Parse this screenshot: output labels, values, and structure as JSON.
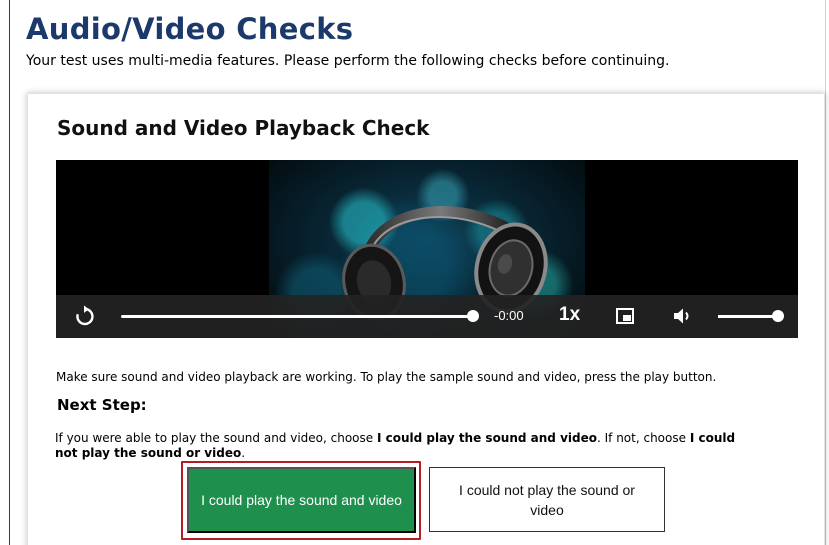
{
  "page": {
    "title": "Audio/Video Checks",
    "subtitle": "Your test uses multi-media features. Please perform the following checks before continuing."
  },
  "card": {
    "title": "Sound and Video Playback Check",
    "instructions": "Make sure sound and video playback are working. To play the sample sound and video, press the play button.",
    "next_step_heading": "Next Step:",
    "choose_text": {
      "part1": "If you were able to play the sound and video, choose ",
      "bold1": "I could play the sound and video",
      "part2": ". If not, choose ",
      "bold2a": "I could",
      "bold2b": "not play the sound or video",
      "part3": "."
    }
  },
  "player": {
    "time_remaining": "-0:00",
    "playback_rate": "1x",
    "progress_fraction": 1.0,
    "volume_fraction": 0.95,
    "poster_subject": "headphones",
    "icons": [
      "replay-icon",
      "picture-in-picture-icon",
      "volume-icon"
    ]
  },
  "buttons": {
    "could_play_label": "I could play the sound and video",
    "could_not_play_label": "I could not play the sound or video"
  },
  "colors": {
    "title": "#1b3a6b",
    "primary_button": "#1f8f4e",
    "focus_ring": "#b41e22",
    "controls_bar": "#232323"
  }
}
